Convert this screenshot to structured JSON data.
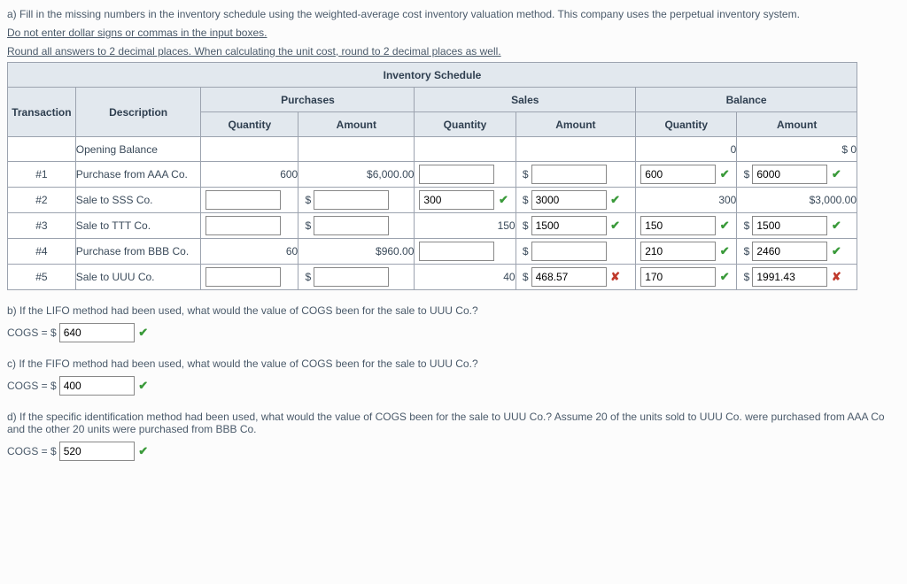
{
  "intro": {
    "a": "a) Fill in the missing numbers in the inventory schedule using the weighted-average cost inventory valuation method. This company uses the perpetual inventory system.",
    "warn1": "Do not enter dollar signs or commas in the input boxes.",
    "warn2": "Round all answers to 2 decimal places. When calculating the unit cost, round to 2 decimal places as well."
  },
  "schedule": {
    "title": "Inventory Schedule",
    "groups": {
      "purchases": "Purchases",
      "sales": "Sales",
      "balance": "Balance"
    },
    "cols": {
      "transaction": "Transaction",
      "description": "Description",
      "quantity": "Quantity",
      "amount": "Amount"
    },
    "rows": {
      "opening": {
        "desc": "Opening Balance",
        "bal_qty": "0",
        "bal_amt": "$ 0"
      },
      "r1": {
        "num": "#1",
        "desc": "Purchase from AAA Co.",
        "pur_qty": "600",
        "pur_amt": "$6,000.00",
        "bal_qty_in": "600",
        "bal_amt_in": "6000"
      },
      "r2": {
        "num": "#2",
        "desc": "Sale to SSS Co.",
        "sale_qty_in": "300",
        "sale_amt_in": "3000",
        "bal_qty": "300",
        "bal_amt": "$3,000.00"
      },
      "r3": {
        "num": "#3",
        "desc": "Sale to TTT Co.",
        "sale_qty": "150",
        "sale_amt_in": "1500",
        "bal_qty_in": "150",
        "bal_amt_in": "1500"
      },
      "r4": {
        "num": "#4",
        "desc": "Purchase from BBB Co.",
        "pur_qty": "60",
        "pur_amt": "$960.00",
        "bal_qty_in": "210",
        "bal_amt_in": "2460"
      },
      "r5": {
        "num": "#5",
        "desc": "Sale to UUU Co.",
        "sale_qty": "40",
        "sale_amt_in": "468.57",
        "bal_qty_in": "170",
        "bal_amt_in": "1991.43"
      }
    }
  },
  "qb": {
    "text": "b) If the LIFO method had been used, what would the value of COGS been for the sale to UUU Co.?",
    "label": "COGS = $",
    "value": "640"
  },
  "qc": {
    "text": "c) If the FIFO method had been used, what would the value of COGS been for the sale to UUU Co.?",
    "label": "COGS = $",
    "value": "400"
  },
  "qd": {
    "text": "d) If the specific identification method had been used, what would the value of COGS been for the sale to UUU Co.? Assume 20 of the units sold to UUU Co. were purchased from AAA Co and the other 20 units were purchased from BBB Co.",
    "label": "COGS = $",
    "value": "520"
  },
  "glyph": {
    "ok": "✔",
    "bad": "✘",
    "dollar": "$"
  }
}
